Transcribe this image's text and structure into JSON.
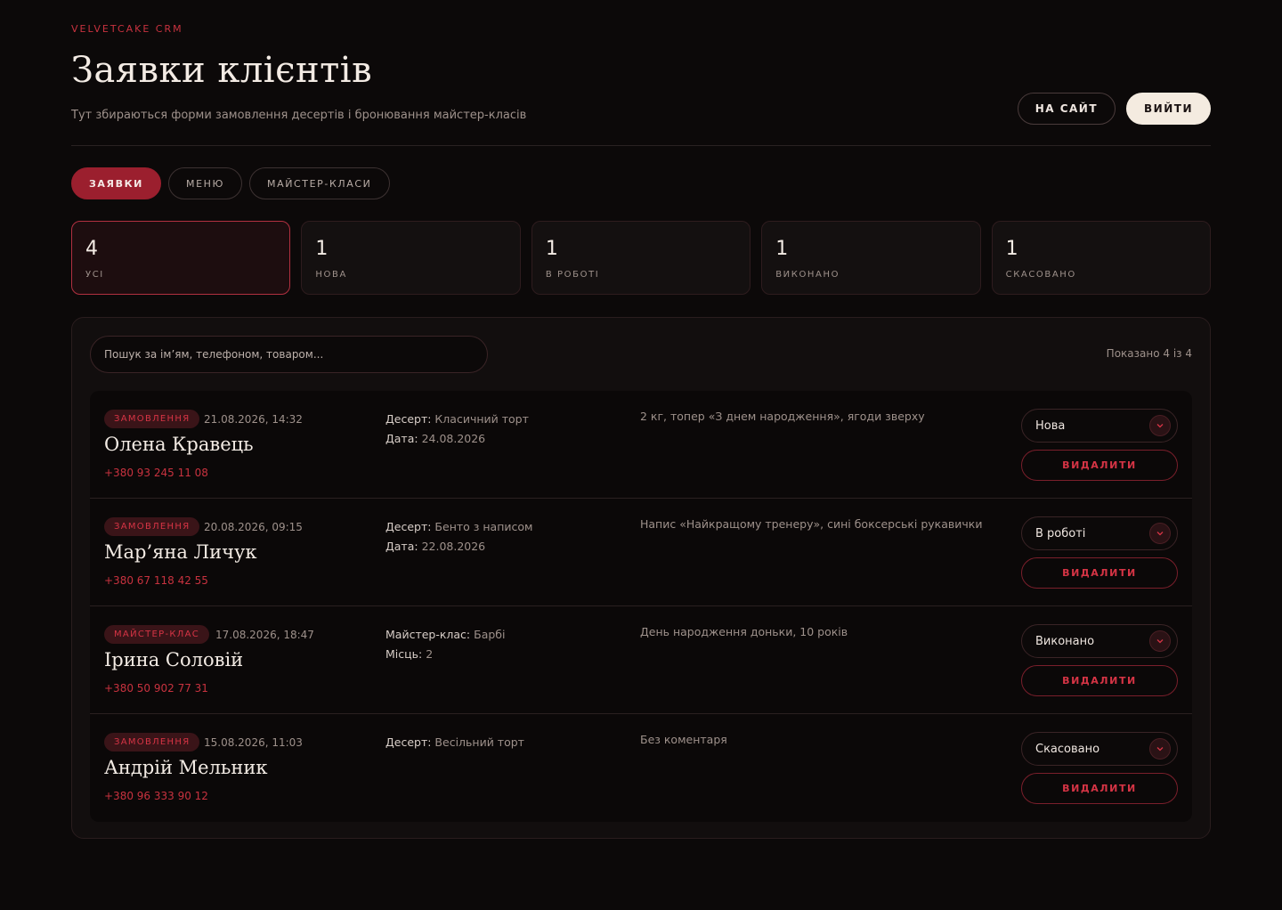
{
  "header": {
    "brand": "VELVETCAKE CRM",
    "title": "Заявки клієнтів",
    "subtitle": "Тут збираються форми замовлення десертів і бронювання майстер-класів",
    "site_button": "НА САЙТ",
    "logout_button": "ВИЙТИ"
  },
  "tabs": [
    {
      "label": "ЗАЯВКИ"
    },
    {
      "label": "МЕНЮ"
    },
    {
      "label": "МАЙСТЕР-КЛАСИ"
    }
  ],
  "stats": [
    {
      "count": "4",
      "label": "УСІ"
    },
    {
      "count": "1",
      "label": "НОВА"
    },
    {
      "count": "1",
      "label": "В РОБОТІ"
    },
    {
      "count": "1",
      "label": "ВИКОНАНО"
    },
    {
      "count": "1",
      "label": "СКАСОВАНО"
    }
  ],
  "search": {
    "placeholder": "Пошук за ім’ям, телефоном, товаром..."
  },
  "shown_text": "Показано 4 із 4",
  "delete_label": "ВИДАЛИТИ",
  "orders": [
    {
      "tag": "ЗАМОВЛЕННЯ",
      "date": "21.08.2026, 14:32",
      "name": "Олена Кравець",
      "phone": "+380 93 245 11 08",
      "detail1_key": "Десерт:",
      "detail1_val": " Класичний торт",
      "detail2_key": "Дата:",
      "detail2_val": " 24.08.2026",
      "comment": "2 кг, топер «З днем народження», ягоди зверху",
      "status": "Нова"
    },
    {
      "tag": "ЗАМОВЛЕННЯ",
      "date": "20.08.2026, 09:15",
      "name": "Мар’яна Личук",
      "phone": "+380 67 118 42 55",
      "detail1_key": "Десерт:",
      "detail1_val": " Бенто з написом",
      "detail2_key": "Дата:",
      "detail2_val": " 22.08.2026",
      "comment": "Напис «Найкращому тренеру», сині боксерські рукавички",
      "status": "В роботі"
    },
    {
      "tag": "МАЙСТЕР-КЛАС",
      "date": "17.08.2026, 18:47",
      "name": "Ірина Соловій",
      "phone": "+380 50 902 77 31",
      "detail1_key": "Майстер-клас:",
      "detail1_val": " Барбі",
      "detail2_key": "Місць:",
      "detail2_val": " 2",
      "comment": "День народження доньки, 10 років",
      "status": "Виконано"
    },
    {
      "tag": "ЗАМОВЛЕННЯ",
      "date": "15.08.2026, 11:03",
      "name": "Андрій Мельник",
      "phone": "+380 96 333 90 12",
      "detail1_key": "Десерт:",
      "detail1_val": " Весільний торт",
      "detail2_key": "",
      "detail2_val": "",
      "comment": "Без коментаря",
      "status": "Скасовано"
    }
  ],
  "colors": {
    "accent": "#9b1f2e",
    "accent_text": "#d63445",
    "background": "#0c0909"
  }
}
